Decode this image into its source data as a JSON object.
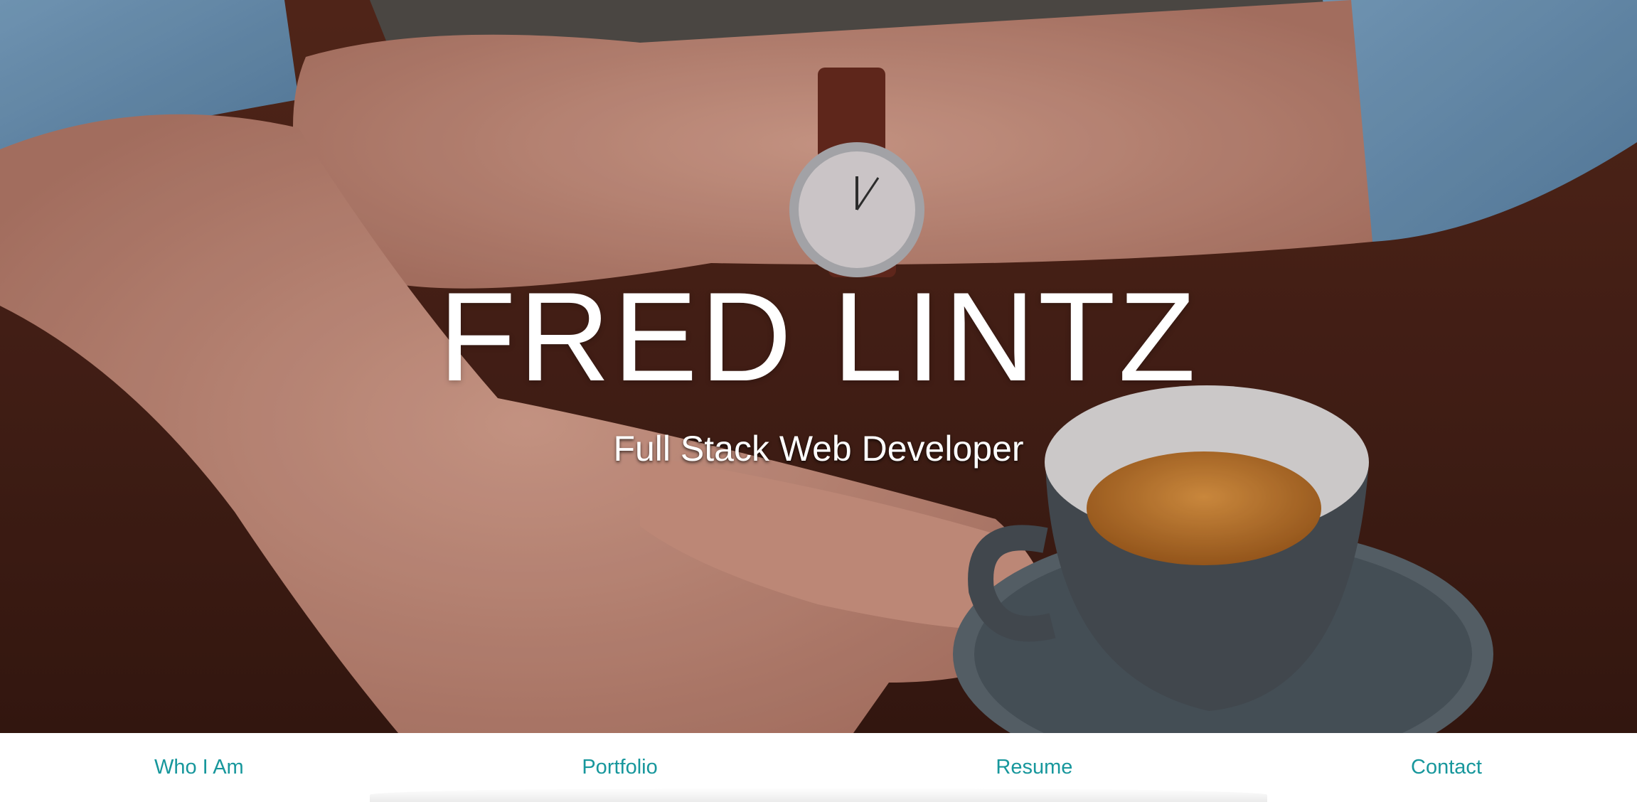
{
  "hero": {
    "title": "FRED LINTZ",
    "subtitle": "Full Stack Web Developer",
    "background_image": "person-with-watch-and-espresso-cup"
  },
  "nav": {
    "items": [
      {
        "label": "Who I Am"
      },
      {
        "label": "Portfolio"
      },
      {
        "label": "Resume"
      },
      {
        "label": "Contact"
      }
    ]
  },
  "colors": {
    "nav_link": "#17979c",
    "hero_text": "#ffffff",
    "table": "#4a2318"
  }
}
